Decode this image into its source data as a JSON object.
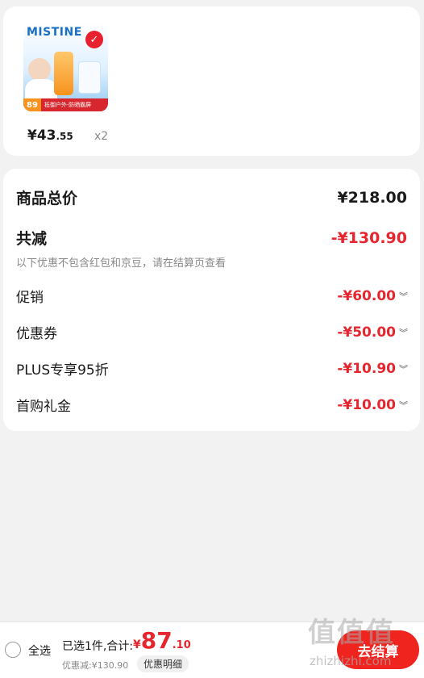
{
  "product": {
    "image_brand": "MISTINE",
    "image_price_tag": "89",
    "image_banner_text": "抵御户外·防晒霸屏",
    "price_int": "¥43",
    "price_dec": ".55",
    "quantity": "x2"
  },
  "summary": {
    "total_label": "商品总价",
    "total_value": "¥218.00",
    "reduce_label": "共减",
    "reduce_value": "-¥130.90",
    "note": "以下优惠不包含红包和京豆，请在结算页查看",
    "items": [
      {
        "label": "促销",
        "value": "-¥60.00"
      },
      {
        "label": "优惠券",
        "value": "-¥50.00"
      },
      {
        "label": "PLUS专享95折",
        "value": "-¥10.90"
      },
      {
        "label": "首购礼金",
        "value": "-¥10.00"
      }
    ]
  },
  "bottom_bar": {
    "select_all": "全选",
    "selected_text": "已选1件,合计:",
    "total_yen": "¥",
    "total_int": "87",
    "total_dec": ".10",
    "discount_text": "优惠减:¥130.90",
    "detail_button": "优惠明细",
    "checkout_button": "去结算"
  },
  "watermark": {
    "logo": "值值值",
    "url": "zhizhizhi.com"
  },
  "colors": {
    "accent_red": "#e6262e",
    "checkout_red": "#f0241f",
    "background": "#f2f2f2"
  },
  "icons": {
    "expand": "chevron-down-icon",
    "select": "radio-icon",
    "selected_badge": "check-icon"
  }
}
